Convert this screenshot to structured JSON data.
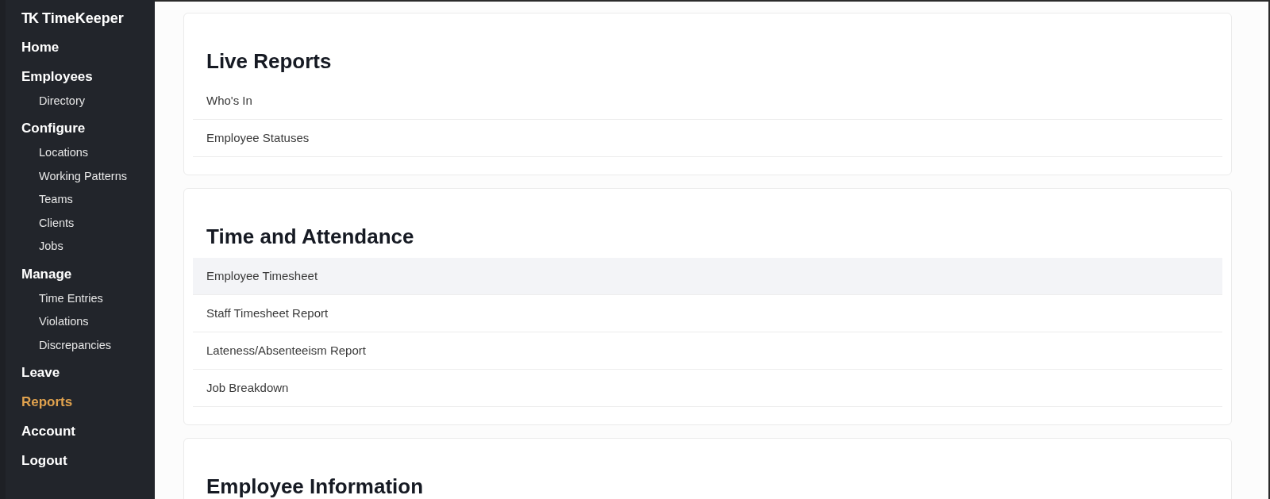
{
  "sidebar": {
    "logo": {
      "mark": "TK",
      "name": "TimeKeeper"
    },
    "items": [
      {
        "label": "Home",
        "selected": false
      },
      {
        "label": "Employees",
        "selected": false,
        "children": [
          {
            "label": "Directory",
            "selected": false
          }
        ]
      },
      {
        "label": "Configure",
        "selected": false,
        "children": [
          {
            "label": "Locations",
            "selected": false
          },
          {
            "label": "Working Patterns",
            "selected": false
          },
          {
            "label": "Teams",
            "selected": false
          },
          {
            "label": "Clients",
            "selected": false
          },
          {
            "label": "Jobs",
            "selected": false
          }
        ]
      },
      {
        "label": "Manage",
        "selected": false,
        "children": [
          {
            "label": "Time Entries",
            "selected": false
          },
          {
            "label": "Violations",
            "selected": false
          },
          {
            "label": "Discrepancies",
            "selected": false
          }
        ]
      },
      {
        "label": "Leave",
        "selected": false
      },
      {
        "label": "Reports",
        "selected": true
      },
      {
        "label": "Account",
        "selected": false
      },
      {
        "label": "Logout",
        "selected": false
      }
    ]
  },
  "sections": [
    {
      "title": "Live Reports",
      "items": [
        {
          "label": "Who's In",
          "highlighted": false
        },
        {
          "label": "Employee Statuses",
          "highlighted": false
        }
      ]
    },
    {
      "title": "Time and Attendance",
      "items": [
        {
          "label": "Employee Timesheet",
          "highlighted": true
        },
        {
          "label": "Staff Timesheet Report",
          "highlighted": false
        },
        {
          "label": "Lateness/Absenteeism Report",
          "highlighted": false
        },
        {
          "label": "Job Breakdown",
          "highlighted": false
        }
      ]
    },
    {
      "title": "Employee Information"
    }
  ]
}
